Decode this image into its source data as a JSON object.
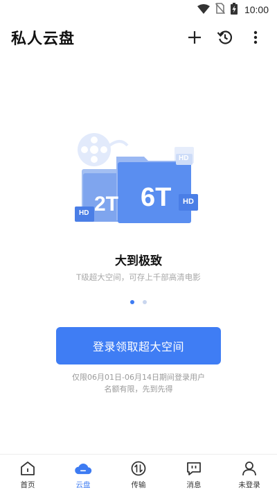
{
  "status_bar": {
    "time": "10:00",
    "icons": [
      "wifi-icon",
      "no-sim-icon",
      "battery-charging-icon"
    ]
  },
  "header": {
    "title": "私人云盘",
    "actions": [
      "add-icon",
      "history-icon",
      "more-vertical-icon"
    ]
  },
  "promo": {
    "badge_large": "6T",
    "badge_small": "2T",
    "hd_label": "HD",
    "title": "大到极致",
    "subtitle": "T级超大空间，可存上千部高清电影",
    "slides": 2,
    "active_slide": 0
  },
  "cta": {
    "label": "登录领取超大空间"
  },
  "notice": {
    "line1": "仅限06月01日-06月14日期间登录用户",
    "line2": "名额有限，先到先得"
  },
  "bottom_nav": {
    "items": [
      {
        "label": "首页",
        "icon": "home-icon",
        "active": false
      },
      {
        "label": "云盘",
        "icon": "cloud-icon",
        "active": true
      },
      {
        "label": "传输",
        "icon": "transfer-icon",
        "active": false
      },
      {
        "label": "消息",
        "icon": "message-icon",
        "active": false
      },
      {
        "label": "未登录",
        "icon": "user-icon",
        "active": false
      }
    ]
  },
  "colors": {
    "accent": "#3f7df4",
    "illustration_primary": "#5a8ef0",
    "illustration_light": "#c5d6f7"
  }
}
